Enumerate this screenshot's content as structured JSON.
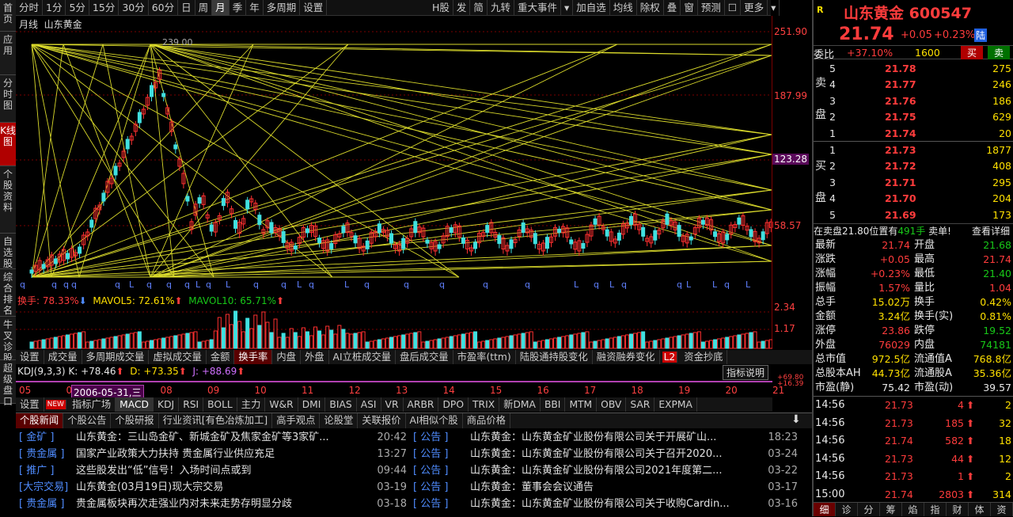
{
  "left_tabs": [
    "首页",
    "应用",
    "分时图",
    "K线图",
    "个股资料",
    "自选股",
    "综合排名",
    "牛叉诊股",
    "超级盘口"
  ],
  "toolbar": [
    "分时",
    "1分",
    "5分",
    "15分",
    "30分",
    "60分",
    "日",
    "周",
    "月",
    "季",
    "年",
    "多周期",
    "设置"
  ],
  "toolbar_right": [
    "H股",
    "发",
    "简",
    "九转",
    "重大事件",
    "▾",
    "加自选",
    "均线",
    "除权",
    "叠",
    "窗",
    "预测",
    "☐",
    "更多",
    "▾"
  ],
  "chart_label": {
    "period": "月线",
    "name": "山东黄金"
  },
  "price_ticks": [
    "251.90",
    "187.99",
    "123.28",
    "58.57"
  ],
  "peak_label": "239.00",
  "vol_ticks": [
    "2.34",
    "1.17"
  ],
  "turnover": {
    "t1": "换手: 78.33%",
    "t2": "MAVOL5: 72.61%",
    "t3": "MAVOL10: 65.71%"
  },
  "vol_tabs": [
    "设置",
    "成交量",
    "多周期成交量",
    "虚拟成交量",
    "金额",
    "换手率",
    "内盘",
    "外盘",
    "AI立桩成交量",
    "盘后成交量",
    "市盈率(ttm)",
    "陆股通持股变化",
    "融资融券变化",
    "资金抄底"
  ],
  "vol_tab_badge": "L2",
  "kdj": {
    "label": "KDJ(9,3,3)",
    "k": "K: +78.46",
    "d": "D: +73.35",
    "j": "J: +88.69",
    "explain": "指标说明",
    "r1": "+69.80",
    "r2": "+16.39"
  },
  "years": [
    "05",
    "06",
    "07",
    "08",
    "09",
    "10",
    "11",
    "12",
    "13",
    "14",
    "15",
    "16",
    "17",
    "18",
    "19",
    "20",
    "21"
  ],
  "date_cursor": "2006-05-31,三",
  "ind_tabs": [
    "设置",
    "NEW",
    "指标广场",
    "MACD",
    "KDJ",
    "RSI",
    "BOLL",
    "主力",
    "W&R",
    "DMI",
    "BIAS",
    "ASI",
    "VR",
    "ARBR",
    "DPO",
    "TRIX",
    "新DMA",
    "BBI",
    "MTM",
    "OBV",
    "SAR",
    "EXPMA"
  ],
  "news_tabs": [
    "个股新闻",
    "个股公告",
    "个股研报",
    "行业资讯[有色冶炼加工]",
    "高手观点",
    "论股堂",
    "关联报价",
    "AI相似个股",
    "商品价格"
  ],
  "news_left": [
    {
      "tag": "[ 金矿 ]",
      "title": "山东黄金：三山岛金矿、新城金矿及焦家金矿等3家矿...",
      "time": "20:42"
    },
    {
      "tag": "[ 贵金属 ]",
      "title": "国家产业政策大力扶持 贵金属行业供应充足",
      "time": "13:27"
    },
    {
      "tag": "[ 推广 ]",
      "title": "这些股发出“低”信号！入场时间点或到",
      "time": "09:44"
    },
    {
      "tag": "[大宗交易]",
      "title": "山东黄金(03月19日)现大宗交易",
      "time": "03-19"
    },
    {
      "tag": "[ 贵金属 ]",
      "title": "贵金属板块再次走强业内对未来走势存明显分歧",
      "time": "03-18"
    }
  ],
  "news_right": [
    {
      "tag": "[ 公告 ]",
      "title": "山东黄金：山东黄金矿业股份有限公司关于开展矿山...",
      "time": "18:23"
    },
    {
      "tag": "[ 公告 ]",
      "title": "山东黄金：山东黄金矿业股份有限公司关于召开2020...",
      "time": "03-24"
    },
    {
      "tag": "[ 公告 ]",
      "title": "山东黄金：山东黄金矿业股份有限公司2021年度第二...",
      "time": "03-22"
    },
    {
      "tag": "[ 公告 ]",
      "title": "山东黄金：董事会会议通告",
      "time": "03-17"
    },
    {
      "tag": "[ 公告 ]",
      "title": "山东黄金：山东黄金矿业股份有限公司关于收购Cardin...",
      "time": "03-16"
    }
  ],
  "stock": {
    "badge": "R",
    "name": "山东黄金",
    "code": "600547",
    "price": "21.74",
    "change": "+0.05",
    "pct": "+0.23%",
    "market": "陆"
  },
  "weibi": {
    "label": "委比",
    "value": "+37.10%",
    "diff": "1600",
    "buy": "买",
    "sell": "卖"
  },
  "asks": [
    {
      "n": "5",
      "p": "21.78",
      "v": "275"
    },
    {
      "n": "4",
      "p": "21.77",
      "v": "246"
    },
    {
      "n": "3",
      "p": "21.76",
      "v": "186"
    },
    {
      "n": "2",
      "p": "21.75",
      "v": "629"
    },
    {
      "n": "1",
      "p": "21.74",
      "v": "20"
    }
  ],
  "bids": [
    {
      "n": "1",
      "p": "21.73",
      "v": "1877"
    },
    {
      "n": "2",
      "p": "21.72",
      "v": "408"
    },
    {
      "n": "3",
      "p": "21.71",
      "v": "295"
    },
    {
      "n": "4",
      "p": "21.70",
      "v": "204"
    },
    {
      "n": "5",
      "p": "21.69",
      "v": "173"
    }
  ],
  "ask_label": [
    "卖",
    "盘"
  ],
  "bid_label": [
    "买",
    "盘"
  ],
  "alert": {
    "text": "在卖盘21.80位置有",
    "amount": "491手",
    "action": "卖单!",
    "link": "查看详细"
  },
  "stats": [
    {
      "l1": "最新",
      "v1": "21.74",
      "c1": "red",
      "l2": "开盘",
      "v2": "21.68",
      "c2": "green"
    },
    {
      "l1": "涨跌",
      "v1": "+0.05",
      "c1": "red",
      "l2": "最高",
      "v2": "21.74",
      "c2": "red"
    },
    {
      "l1": "涨幅",
      "v1": "+0.23%",
      "c1": "red",
      "l2": "最低",
      "v2": "21.40",
      "c2": "green"
    },
    {
      "l1": "振幅",
      "v1": "1.57%",
      "c1": "red",
      "l2": "量比",
      "v2": "1.04",
      "c2": "red"
    },
    {
      "l1": "总手",
      "v1": "15.02万",
      "c1": "yel",
      "l2": "换手",
      "v2": "0.42%",
      "c2": "yel"
    },
    {
      "l1": "金额",
      "v1": "3.24亿",
      "c1": "yel",
      "l2": "换手(实)",
      "v2": "0.81%",
      "c2": "yel"
    },
    {
      "l1": "涨停",
      "v1": "23.86",
      "c1": "red",
      "l2": "跌停",
      "v2": "19.52",
      "c2": "green"
    },
    {
      "l1": "外盘",
      "v1": "76029",
      "c1": "red",
      "l2": "内盘",
      "v2": "74181",
      "c2": "green"
    },
    {
      "l1": "总市值",
      "v1": "972.5亿",
      "c1": "yel",
      "l2": "流通值A",
      "v2": "768.8亿",
      "c2": "yel"
    },
    {
      "l1": "总股本AH",
      "v1": "44.73亿",
      "c1": "yel",
      "l2": "流通股A",
      "v2": "35.36亿",
      "c2": "yel"
    },
    {
      "l1": "市盈(静)",
      "v1": "75.42",
      "c1": "wht",
      "l2": "市盈(动)",
      "v2": "39.57",
      "c2": "wht"
    }
  ],
  "ticks": [
    {
      "t": "14:56",
      "p": "21.73",
      "v": "4",
      "n": "2"
    },
    {
      "t": "14:56",
      "p": "21.73",
      "v": "185",
      "n": "32"
    },
    {
      "t": "14:56",
      "p": "21.74",
      "v": "582",
      "n": "18"
    },
    {
      "t": "14:56",
      "p": "21.73",
      "v": "44",
      "n": "12"
    },
    {
      "t": "14:56",
      "p": "21.73",
      "v": "1",
      "n": "2"
    },
    {
      "t": "15:00",
      "p": "21.74",
      "v": "2803",
      "n": "314"
    }
  ],
  "bottom_tabs": [
    "细",
    "诊",
    "分",
    "筹",
    "焰",
    "指",
    "财",
    "体",
    "资"
  ]
}
